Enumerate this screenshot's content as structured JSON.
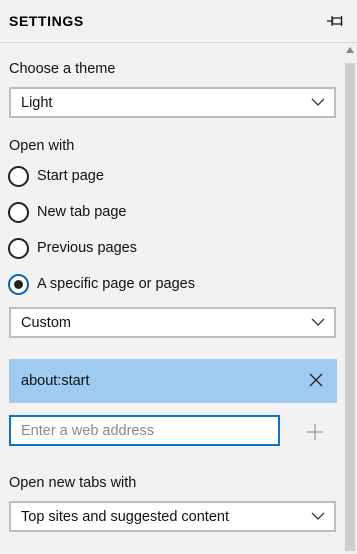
{
  "header": {
    "title": "SETTINGS",
    "pin_icon": "pin-icon"
  },
  "theme": {
    "label": "Choose a theme",
    "selected": "Light"
  },
  "open_with": {
    "label": "Open with",
    "options": [
      {
        "label": "Start page",
        "checked": false
      },
      {
        "label": "New tab page",
        "checked": false
      },
      {
        "label": "Previous pages",
        "checked": false
      },
      {
        "label": "A specific page or pages",
        "checked": true
      }
    ],
    "specific_select": "Custom",
    "page_entry": "about:start",
    "address_placeholder": "Enter a web address"
  },
  "new_tabs": {
    "label": "Open new tabs with",
    "selected": "Top sites and suggested content"
  },
  "colors": {
    "accent": "#0063b1",
    "selection": "#9ecbef",
    "focus_border": "#0e74c5"
  }
}
